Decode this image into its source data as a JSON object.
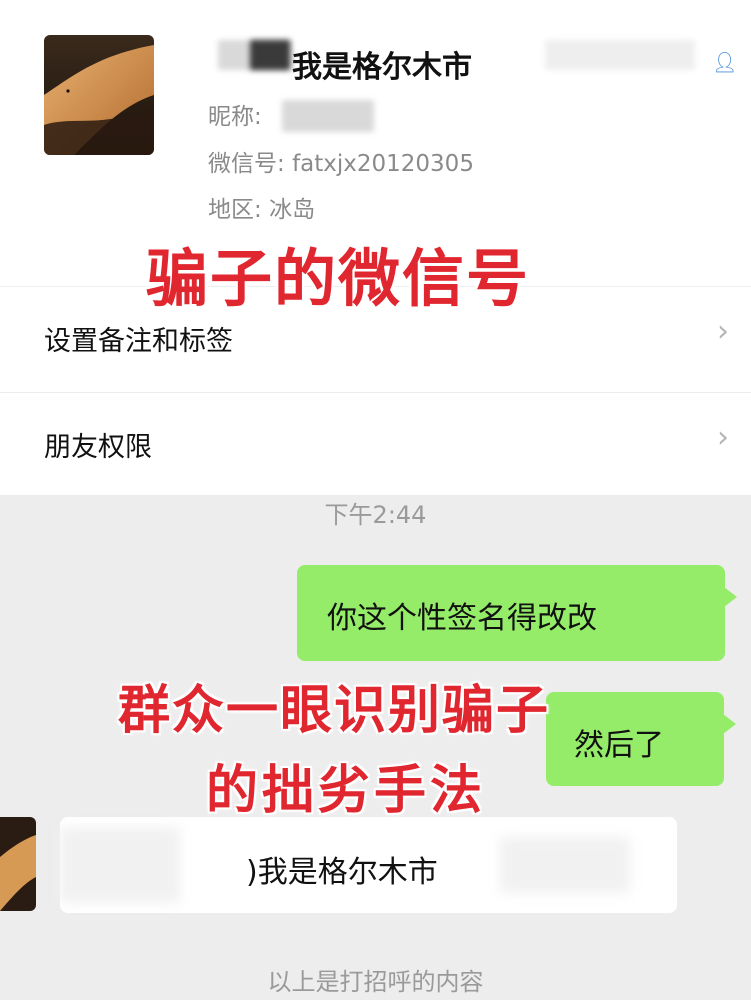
{
  "profile": {
    "display_name": "我是格尔木市",
    "nickname_label": "昵称:",
    "wechat_id_label": "微信号:",
    "wechat_id": "fatxjx20120305",
    "region_label": "地区:",
    "region": "冰岛",
    "gender_icon": "male-user-icon",
    "gender_color": "#4a8fd9"
  },
  "menu": {
    "remark_label": "设置备注和标签",
    "permissions_label": "朋友权限",
    "chevron_icon": "chevron-right-icon"
  },
  "chat": {
    "timestamp": "下午2:44",
    "messages": [
      {
        "from": "me",
        "text": "你这个性签名得改改"
      },
      {
        "from": "me",
        "text": "然后了"
      },
      {
        "from": "friend",
        "text": ")我是格尔木市"
      }
    ],
    "greeting_note": "以上是打招呼的内容",
    "my_bubble_color": "#95ec69"
  },
  "overlays": {
    "caption_1": "骗子的微信号",
    "caption_2_line1": "群众一眼识别骗子",
    "caption_2_line2": "的拙劣手法",
    "caption_color": "#e0262e"
  }
}
